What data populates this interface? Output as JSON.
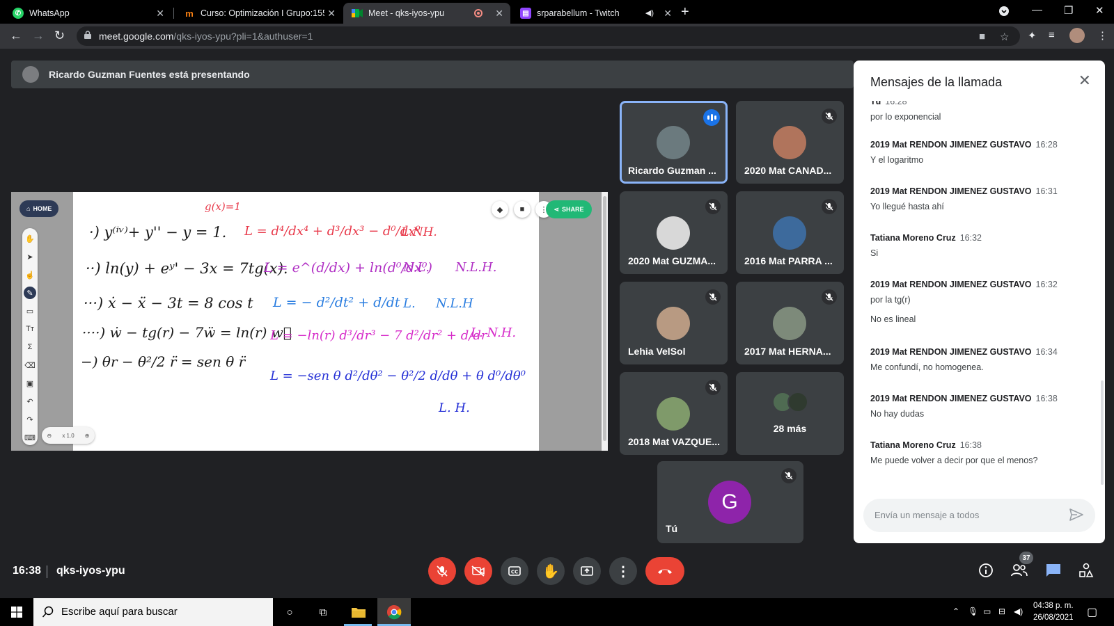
{
  "browser": {
    "tabs": [
      {
        "title": "WhatsApp",
        "icon": "whatsapp-icon",
        "active": false
      },
      {
        "title": "Curso: Optimización I Grupo:155",
        "icon": "moodle-icon",
        "active": false
      },
      {
        "title": "Meet - qks-iyos-ypu",
        "icon": "meet-icon",
        "active": true
      },
      {
        "title": "srparabellum - Twitch",
        "icon": "twitch-icon",
        "active": false
      }
    ],
    "url_host": "meet.google.com",
    "url_path": "/qks-iyos-ypu?pli=1&authuser=1"
  },
  "presenting_banner": "Ricardo Guzman Fuentes está presentando",
  "whiteboard": {
    "home_label": "HOME",
    "share_label": "SHARE",
    "zoom": "x 1.0",
    "lines": {
      "g": "g(x)=1",
      "eq1": "·)  y⁽ⁱᵛ⁾+ y'' − y = 1.",
      "eq2": "··)  ln(y) + eʸ' − 3x = 7tg(x).",
      "eq3": "···)  ẋ − ẍ − 3t = 8 cos t",
      "eq4": "····)  ẇ − tg(r) − 7ẅ = ln(r) w⃛",
      "eq5": "−)  θr − θ²/2 r̈ = sen θ r̈",
      "op1": "L = d⁴/dx⁴ + d³/dx³ − d⁰/dx⁰",
      "op2": "L = e^(d/dx) + ln(d⁰/dx⁰)",
      "op3": "L = − d²/dt² + d/dt",
      "op4": "L = −ln(r) d³/dr³ − 7 d²/dr² + d/dr",
      "op5": "L = −sen θ d²/dθ² − θ²/2 d/dθ + θ d⁰/dθ⁰",
      "c1": "L.NH.",
      "c2a": "N.L.",
      "c2b": "N.L.H.",
      "c3a": "L.",
      "c3b": "N.L.H",
      "c4": "L. N.H.",
      "c5": "L. H."
    }
  },
  "participants": [
    {
      "name": "Ricardo Guzman ...",
      "speaking": true,
      "muted": false,
      "photo_color": "#6b7a7e"
    },
    {
      "name": "2020 Mat CANAD...",
      "speaking": false,
      "muted": true,
      "photo_color": "#b0745c"
    },
    {
      "name": "2020 Mat GUZMA...",
      "speaking": false,
      "muted": true,
      "photo_color": "#d8d8d8"
    },
    {
      "name": "2016 Mat PARRA ...",
      "speaking": false,
      "muted": true,
      "photo_color": "#3d6a9c"
    },
    {
      "name": "Lehia VelSol",
      "speaking": false,
      "muted": true,
      "photo_color": "#b89a82"
    },
    {
      "name": "2017 Mat HERNA...",
      "speaking": false,
      "muted": true,
      "photo_color": "#7d8a7a"
    },
    {
      "name": "2018 Mat VAZQUE...",
      "speaking": false,
      "muted": true,
      "photo_color": "#7f9a6a"
    }
  ],
  "more_tile": {
    "label": "28 más",
    "avatar_colors": [
      "#4f6b52",
      "#2f3a2f"
    ]
  },
  "self_tile": {
    "name": "Tú",
    "initial": "G",
    "color": "#8e24aa"
  },
  "chat": {
    "title": "Mensajes de la llamada",
    "messages": [
      {
        "sender": "Tú",
        "time": "16:28",
        "lines": [
          "por lo exponencial"
        ]
      },
      {
        "sender": "2019 Mat RENDON JIMENEZ GUSTAVO",
        "time": "16:28",
        "lines": [
          "Y el logaritmo"
        ]
      },
      {
        "sender": "2019 Mat RENDON JIMENEZ GUSTAVO",
        "time": "16:31",
        "lines": [
          "Yo llegué hasta ahí"
        ]
      },
      {
        "sender": "Tatiana Moreno Cruz",
        "time": "16:32",
        "lines": [
          "Si"
        ]
      },
      {
        "sender": "2019 Mat RENDON JIMENEZ GUSTAVO",
        "time": "16:32",
        "lines": [
          "por la tg(r)",
          "No es lineal"
        ]
      },
      {
        "sender": "2019 Mat RENDON JIMENEZ GUSTAVO",
        "time": "16:34",
        "lines": [
          "Me confundí, no homogenea."
        ]
      },
      {
        "sender": "2019 Mat RENDON JIMENEZ GUSTAVO",
        "time": "16:38",
        "lines": [
          "No hay dudas"
        ]
      },
      {
        "sender": "Tatiana Moreno Cruz",
        "time": "16:38",
        "lines": [
          "Me puede volver a decir por que el menos?"
        ]
      }
    ],
    "input_placeholder": "Envía un mensaje a todos"
  },
  "meeting": {
    "time": "16:38",
    "code": "qks-iyos-ypu",
    "participant_count": "37"
  },
  "taskbar": {
    "search_placeholder": "Escribe aquí para buscar",
    "time": "04:38 p. m.",
    "date": "26/08/2021"
  },
  "colors": {
    "accent": "#1a73e8",
    "danger": "#ea4335",
    "speaking_border": "#8ab4f8"
  }
}
